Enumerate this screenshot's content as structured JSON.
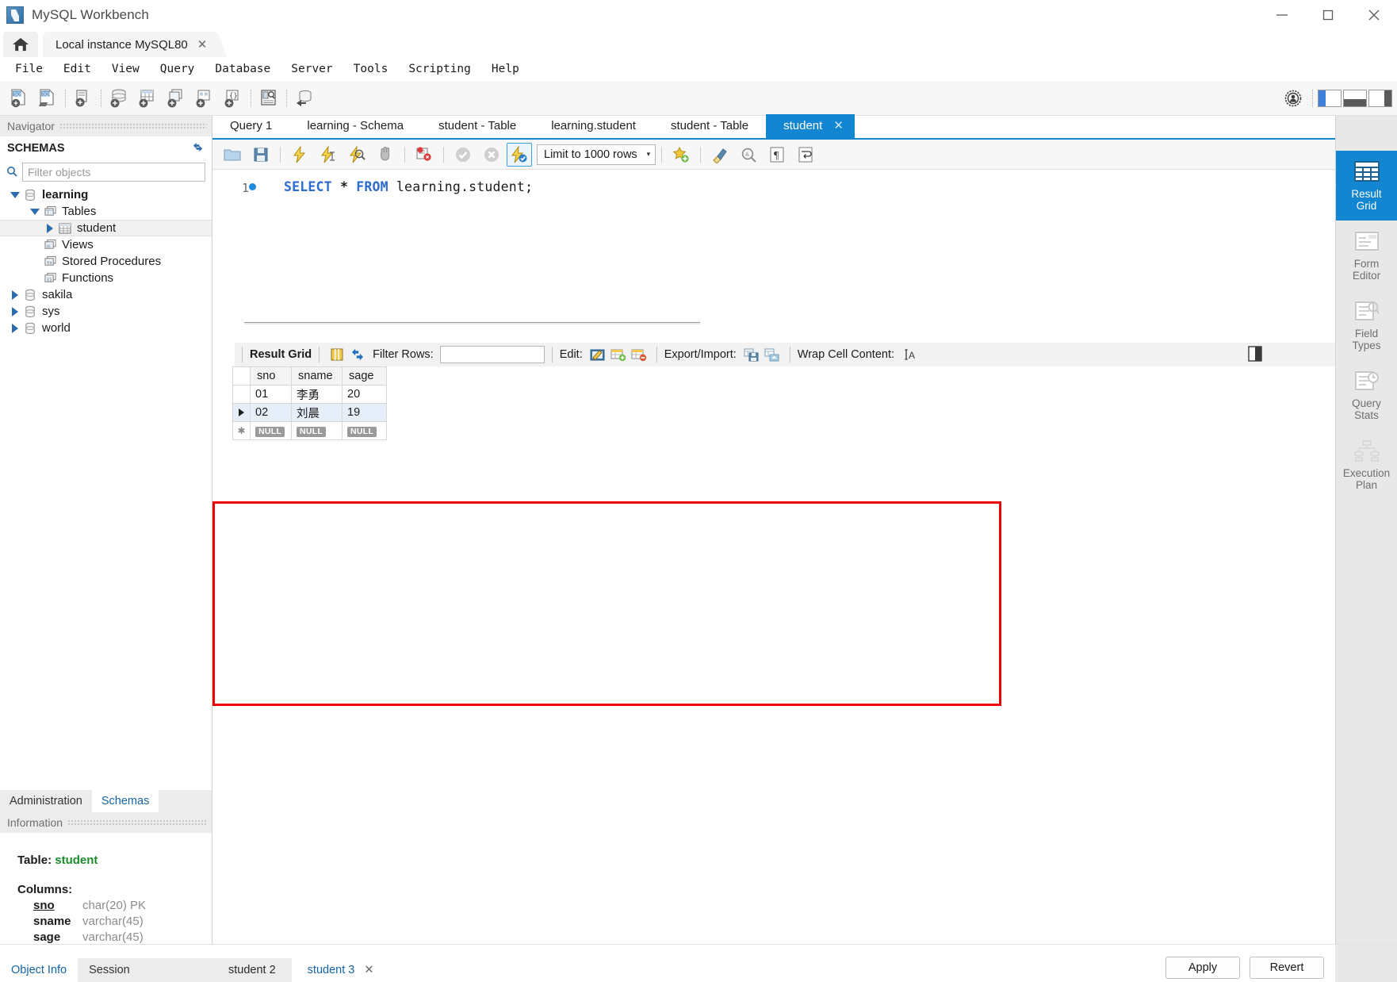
{
  "window": {
    "title": "MySQL Workbench",
    "minimize": "—",
    "maximize": "☐",
    "close": "✕"
  },
  "connection_tabs": {
    "home_icon": "home-icon",
    "tabs": [
      {
        "label": "Local instance MySQL80",
        "close": "✕",
        "active": true
      }
    ]
  },
  "menubar": {
    "items": [
      "File",
      "Edit",
      "View",
      "Query",
      "Database",
      "Server",
      "Tools",
      "Scripting",
      "Help"
    ]
  },
  "main_toolbar": {
    "icons": [
      "new-sql-tab-icon",
      "open-sql-script-icon",
      "connect-to-database-icon",
      "new-schema-icon",
      "new-table-icon",
      "new-view-icon",
      "new-procedure-icon",
      "new-function-icon",
      "edit-table-data-icon",
      "reverse-engineer-icon"
    ],
    "right_icons": [
      "settings-icon",
      "layout-sidebar-icon",
      "layout-output-icon",
      "layout-secondary-sidebar-icon"
    ]
  },
  "navigator": {
    "header": "Navigator",
    "section_title": "SCHEMAS",
    "refresh_icon": "refresh-icon",
    "search_icon": "search-icon",
    "filter_placeholder": "Filter objects",
    "filter_value": "",
    "tree": [
      {
        "label": "learning",
        "icon": "schema-icon",
        "expanded": true,
        "level": 0,
        "bold": true,
        "selected": false
      },
      {
        "label": "Tables",
        "icon": "folder-tables-icon",
        "expanded": true,
        "level": 1,
        "bold": false,
        "selected": false
      },
      {
        "label": "student",
        "icon": "table-icon",
        "expanded": false,
        "level": 2,
        "bold": false,
        "selected": true
      },
      {
        "label": "Views",
        "icon": "folder-views-icon",
        "expanded": null,
        "level": 1,
        "bold": false,
        "selected": false
      },
      {
        "label": "Stored Procedures",
        "icon": "folder-procedures-icon",
        "expanded": null,
        "level": 1,
        "bold": false,
        "selected": false
      },
      {
        "label": "Functions",
        "icon": "folder-functions-icon",
        "expanded": null,
        "level": 1,
        "bold": false,
        "selected": false
      },
      {
        "label": "sakila",
        "icon": "schema-icon",
        "expanded": false,
        "level": 0,
        "bold": false,
        "selected": false
      },
      {
        "label": "sys",
        "icon": "schema-icon",
        "expanded": false,
        "level": 0,
        "bold": false,
        "selected": false
      },
      {
        "label": "world",
        "icon": "schema-icon",
        "expanded": false,
        "level": 0,
        "bold": false,
        "selected": false
      }
    ],
    "bottom_tabs": [
      {
        "label": "Administration",
        "active": false
      },
      {
        "label": "Schemas",
        "active": true
      }
    ]
  },
  "information": {
    "header": "Information",
    "table_label": "Table:",
    "table_name": "student",
    "columns_label": "Columns:",
    "columns": [
      {
        "name": "sno",
        "type": "char(20) PK",
        "pk": true
      },
      {
        "name": "sname",
        "type": "varchar(45)",
        "pk": false
      },
      {
        "name": "sage",
        "type": "varchar(45)",
        "pk": false
      }
    ]
  },
  "editor": {
    "tabs": [
      {
        "label": "Query 1",
        "active": false
      },
      {
        "label": "learning - Schema",
        "active": false
      },
      {
        "label": "student - Table",
        "active": false
      },
      {
        "label": "learning.student",
        "active": false
      },
      {
        "label": "student - Table",
        "active": false
      },
      {
        "label": "student",
        "active": true,
        "close": "✕"
      }
    ],
    "toolbar": {
      "icons": [
        "open-script-icon",
        "save-script-icon",
        "execute-statement-icon",
        "execute-current-statement-icon",
        "explain-query-icon",
        "stop-execution-icon",
        "toggle-stop-on-error-icon",
        "commit-icon",
        "rollback-icon",
        "toggle-autocommit-icon"
      ],
      "limit_label": "Limit to 1000 rows",
      "limit_caret": "▾",
      "right_icons": [
        "add-snippet-icon",
        "beautify-query-icon",
        "find-icon",
        "toggle-invisible-chars-icon",
        "wrap-lines-icon"
      ]
    },
    "line_number": "1",
    "sql": {
      "keyword1": "SELECT",
      "star": "*",
      "keyword2": "FROM",
      "target": "learning.student;"
    }
  },
  "result_panel": {
    "toolbar": {
      "result_grid_label": "Result Grid",
      "grid_view_icon": "grid-view-icon",
      "refresh_icon": "refresh-grid-icon",
      "filter_rows_label": "Filter Rows:",
      "filter_rows_value": "",
      "edit_label": "Edit:",
      "edit_icons": [
        "edit-cell-icon",
        "insert-row-icon",
        "delete-row-icon"
      ],
      "export_import_label": "Export/Import:",
      "export_icons": [
        "export-recordset-icon",
        "import-recordset-icon"
      ],
      "wrap_label": "Wrap Cell Content:",
      "wrap_icon": "wrap-cell-icon",
      "panel_toggle_icon": "toggle-side-panel-icon"
    },
    "grid": {
      "columns": [
        "sno",
        "sname",
        "sage"
      ],
      "rows": [
        {
          "sno": "01",
          "sname": "李勇",
          "sage": "20",
          "marker": "",
          "selected": false
        },
        {
          "sno": "02",
          "sname": "刘晨",
          "sage": "19",
          "marker": "▶",
          "selected": true
        }
      ],
      "new_row": {
        "sno": "NULL",
        "sname": "NULL",
        "sage": "NULL",
        "marker": "✱"
      }
    }
  },
  "right_rail": {
    "items": [
      {
        "label_line1": "Result",
        "label_line2": "Grid",
        "icon": "result-grid-icon",
        "active": true
      },
      {
        "label_line1": "Form",
        "label_line2": "Editor",
        "icon": "form-editor-icon",
        "active": false
      },
      {
        "label_line1": "Field",
        "label_line2": "Types",
        "icon": "field-types-icon",
        "active": false
      },
      {
        "label_line1": "Query",
        "label_line2": "Stats",
        "icon": "query-stats-icon",
        "active": false
      },
      {
        "label_line1": "Execution",
        "label_line2": "Plan",
        "icon": "execution-plan-icon",
        "active": false
      }
    ]
  },
  "bottom": {
    "left_tabs": [
      {
        "label": "Object Info",
        "active": true
      },
      {
        "label": "Session",
        "active": false
      }
    ],
    "result_tabs": [
      {
        "label": "student 2",
        "active": false
      },
      {
        "label": "student 3",
        "active": true,
        "close": "✕"
      }
    ],
    "buttons": [
      {
        "label": "Apply"
      },
      {
        "label": "Revert"
      }
    ]
  },
  "colors": {
    "accent_blue": "#1286d0",
    "highlight_red": "#ee0000",
    "keyword_blue": "#2d6ccf",
    "green_table": "#1a8c2c"
  }
}
